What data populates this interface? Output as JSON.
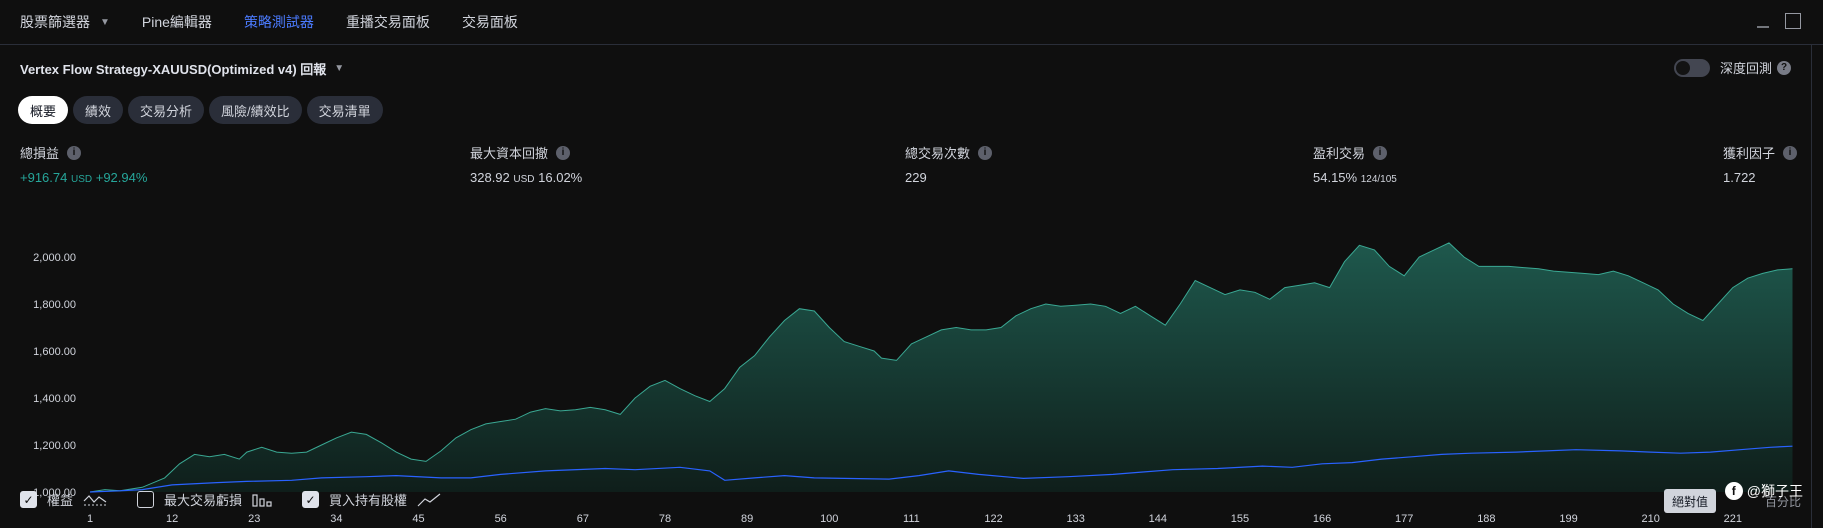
{
  "top_tabs": [
    {
      "label": "股票篩選器",
      "has_dropdown": true
    },
    {
      "label": "Pine編輯器"
    },
    {
      "label": "策略測試器",
      "active": true
    },
    {
      "label": "重播交易面板"
    },
    {
      "label": "交易面板"
    }
  ],
  "strategy": {
    "title": "Vertex Flow Strategy-XAUUSD(Optimized v4) 回報"
  },
  "deep_backtest": {
    "label": "深度回測",
    "enabled": false
  },
  "tabs": [
    {
      "label": "概要",
      "active": true
    },
    {
      "label": "績效"
    },
    {
      "label": "交易分析"
    },
    {
      "label": "風險/績效比"
    },
    {
      "label": "交易清單"
    }
  ],
  "metrics": {
    "net_profit": {
      "label": "總損益",
      "value": "+916.74",
      "unit": "USD",
      "pct": "+92.94%"
    },
    "max_drawdown": {
      "label": "最大資本回撤",
      "value": "328.92",
      "unit": "USD",
      "pct": "16.02%"
    },
    "total_trades": {
      "label": "總交易次數",
      "value": "229"
    },
    "profitable": {
      "label": "盈利交易",
      "value": "54.15%",
      "detail": "124/105"
    },
    "profit_factor": {
      "label": "獲利因子",
      "value": "1.722"
    }
  },
  "legend": {
    "equity": {
      "label": "權益",
      "checked": true
    },
    "drawdown": {
      "label": "最大交易虧損",
      "checked": false
    },
    "buy_hold": {
      "label": "買入持有股權",
      "checked": true
    }
  },
  "buttons": {
    "absolute": "絕對值",
    "percent": "百分比"
  },
  "watermark": {
    "text": "@獅子王"
  },
  "colors": {
    "equity": "#26a69a",
    "buy_hold": "#2962ff",
    "accent": "#4b7bff"
  },
  "chart_data": {
    "type": "area",
    "ylim": [
      1000,
      2000
    ],
    "y_ticks": [
      1000,
      1200,
      1400,
      1600,
      1800,
      2000
    ],
    "y_tick_labels": [
      "1,000.00",
      "1,200.00",
      "1,400.00",
      "1,600.00",
      "1,800.00",
      "2,000.00"
    ],
    "x_ticks": [
      1,
      12,
      23,
      34,
      45,
      56,
      67,
      78,
      89,
      100,
      111,
      122,
      133,
      144,
      155,
      166,
      177,
      188,
      199,
      210,
      221
    ],
    "xlim": [
      1,
      230
    ],
    "series": [
      {
        "name": "權益",
        "x": [
          1,
          3,
          5,
          8,
          11,
          13,
          15,
          17,
          19,
          21,
          22,
          24,
          26,
          28,
          30,
          32,
          34,
          36,
          38,
          40,
          42,
          44,
          46,
          48,
          50,
          52,
          54,
          56,
          58,
          60,
          62,
          64,
          66,
          68,
          70,
          72,
          74,
          76,
          78,
          80,
          82,
          84,
          86,
          88,
          90,
          92,
          94,
          96,
          98,
          100,
          102,
          104,
          106,
          107,
          109,
          111,
          113,
          115,
          117,
          119,
          121,
          123,
          125,
          127,
          129,
          131,
          133,
          135,
          137,
          139,
          141,
          143,
          145,
          147,
          149,
          151,
          153,
          155,
          157,
          159,
          161,
          163,
          165,
          167,
          169,
          171,
          173,
          175,
          177,
          179,
          181,
          183,
          185,
          187,
          189,
          191,
          193,
          195,
          197,
          199,
          201,
          203,
          205,
          207,
          209,
          211,
          213,
          215,
          217,
          219,
          221,
          223,
          225,
          227,
          229
        ],
        "values": [
          1000,
          1010,
          1005,
          1020,
          1060,
          1120,
          1160,
          1150,
          1160,
          1140,
          1170,
          1190,
          1170,
          1165,
          1170,
          1200,
          1230,
          1255,
          1245,
          1210,
          1170,
          1140,
          1130,
          1175,
          1230,
          1265,
          1290,
          1300,
          1310,
          1340,
          1355,
          1345,
          1350,
          1360,
          1350,
          1330,
          1400,
          1450,
          1475,
          1440,
          1410,
          1385,
          1440,
          1530,
          1580,
          1660,
          1730,
          1780,
          1770,
          1700,
          1640,
          1620,
          1600,
          1570,
          1560,
          1630,
          1660,
          1690,
          1700,
          1690,
          1690,
          1700,
          1750,
          1780,
          1800,
          1790,
          1795,
          1800,
          1790,
          1760,
          1790,
          1750,
          1710,
          1800,
          1900,
          1870,
          1840,
          1860,
          1850,
          1820,
          1870,
          1880,
          1890,
          1870,
          1980,
          2050,
          2030,
          1960,
          1920,
          2000,
          2030,
          2060,
          2000,
          1960,
          1960,
          1960,
          1955,
          1950,
          1940,
          1935,
          1930,
          1925,
          1940,
          1920,
          1890,
          1860,
          1800,
          1760,
          1730,
          1800,
          1870,
          1910,
          1930,
          1945,
          1950
        ]
      },
      {
        "name": "買入持有股權",
        "x": [
          1,
          5,
          8,
          12,
          18,
          22,
          28,
          32,
          38,
          42,
          48,
          52,
          56,
          62,
          70,
          74,
          80,
          84,
          86,
          90,
          94,
          98,
          102,
          108,
          112,
          116,
          120,
          126,
          132,
          138,
          142,
          146,
          152,
          158,
          162,
          166,
          170,
          174,
          178,
          182,
          186,
          192,
          196,
          200,
          206,
          210,
          214,
          218,
          222,
          226,
          229
        ],
        "values": [
          1000,
          1005,
          1010,
          1030,
          1040,
          1045,
          1050,
          1060,
          1065,
          1070,
          1060,
          1060,
          1075,
          1090,
          1100,
          1095,
          1105,
          1090,
          1050,
          1060,
          1070,
          1060,
          1058,
          1055,
          1070,
          1090,
          1075,
          1058,
          1065,
          1075,
          1085,
          1095,
          1100,
          1110,
          1105,
          1120,
          1125,
          1140,
          1150,
          1160,
          1165,
          1170,
          1175,
          1180,
          1175,
          1170,
          1165,
          1170,
          1180,
          1190,
          1195
        ]
      }
    ]
  }
}
